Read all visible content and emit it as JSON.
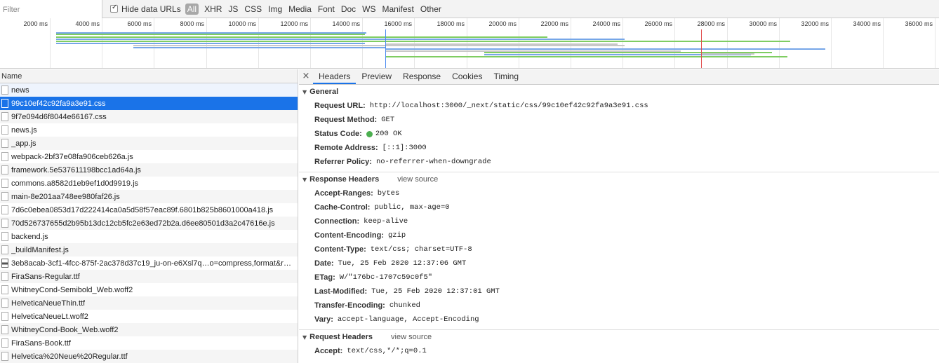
{
  "toolbar": {
    "filter_placeholder": "Filter",
    "hide_data_urls_label": "Hide data URLs",
    "hide_data_urls_checked": true,
    "types": [
      "All",
      "XHR",
      "JS",
      "CSS",
      "Img",
      "Media",
      "Font",
      "Doc",
      "WS",
      "Manifest",
      "Other"
    ],
    "active_type": "All"
  },
  "overview": {
    "tick_labels": [
      "2000 ms",
      "4000 ms",
      "6000 ms",
      "8000 ms",
      "10000 ms",
      "12000 ms",
      "14000 ms",
      "16000 ms",
      "18000 ms",
      "20000 ms",
      "22000 ms",
      "24000 ms",
      "26000 ms",
      "28000 ms",
      "30000 ms",
      "32000 ms",
      "34000 ms",
      "36000 ms"
    ]
  },
  "list": {
    "column_header": "Name",
    "selected_index": 1,
    "rows": [
      {
        "name": "news",
        "icon": "document-icon"
      },
      {
        "name": "99c10ef42c92fa9a3e91.css",
        "icon": "document-icon"
      },
      {
        "name": "9f7e094d6f8044e66167.css",
        "icon": "document-icon"
      },
      {
        "name": "news.js",
        "icon": "document-icon"
      },
      {
        "name": "_app.js",
        "icon": "document-icon"
      },
      {
        "name": "webpack-2bf37e08fa906ceb626a.js",
        "icon": "document-icon"
      },
      {
        "name": "framework.5e537611198bcc1ad64a.js",
        "icon": "document-icon"
      },
      {
        "name": "commons.a8582d1eb9ef1d0d9919.js",
        "icon": "document-icon"
      },
      {
        "name": "main-8e201aa748ee980faf26.js",
        "icon": "document-icon"
      },
      {
        "name": "7d6c0ebea0853d17d222414ca0a5d58f57eac89f.6801b825b8601000a418.js",
        "icon": "document-icon"
      },
      {
        "name": "70d526737655d2b95b13dc12cb5fc2e63ed72b2a.d6ee80501d3a2c47616e.js",
        "icon": "document-icon"
      },
      {
        "name": "backend.js",
        "icon": "document-icon"
      },
      {
        "name": "_buildManifest.js",
        "icon": "document-icon"
      },
      {
        "name": "3eb8acab-3cf1-4fcc-875f-2ac378d37c19_ju-on-e6Xsl7q…o=compress,format&r…",
        "icon": "image-icon"
      },
      {
        "name": "FiraSans-Regular.ttf",
        "icon": "document-icon"
      },
      {
        "name": "WhitneyCond-Semibold_Web.woff2",
        "icon": "document-icon"
      },
      {
        "name": "HelveticaNeueThin.ttf",
        "icon": "document-icon"
      },
      {
        "name": "HelveticaNeueLt.woff2",
        "icon": "document-icon"
      },
      {
        "name": "WhitneyCond-Book_Web.woff2",
        "icon": "document-icon"
      },
      {
        "name": "FiraSans-Book.ttf",
        "icon": "document-icon"
      },
      {
        "name": "Helvetica%20Neue%20Regular.ttf",
        "icon": "document-icon"
      }
    ]
  },
  "details": {
    "close_glyph": "×",
    "tabs": [
      "Headers",
      "Preview",
      "Response",
      "Cookies",
      "Timing"
    ],
    "active_tab": "Headers",
    "general": {
      "title": "General",
      "items": [
        {
          "key": "Request URL:",
          "value": "http://localhost:3000/_next/static/css/99c10ef42c92fa9a3e91.css"
        },
        {
          "key": "Request Method:",
          "value": "GET"
        },
        {
          "key": "Status Code:",
          "value": "200 OK",
          "status_color": "#4caf50"
        },
        {
          "key": "Remote Address:",
          "value": "[::1]:3000"
        },
        {
          "key": "Referrer Policy:",
          "value": "no-referrer-when-downgrade"
        }
      ]
    },
    "response_headers": {
      "title": "Response Headers",
      "view_source": "view source",
      "items": [
        {
          "key": "Accept-Ranges:",
          "value": "bytes"
        },
        {
          "key": "Cache-Control:",
          "value": "public, max-age=0"
        },
        {
          "key": "Connection:",
          "value": "keep-alive"
        },
        {
          "key": "Content-Encoding:",
          "value": "gzip"
        },
        {
          "key": "Content-Type:",
          "value": "text/css; charset=UTF-8"
        },
        {
          "key": "Date:",
          "value": "Tue, 25 Feb 2020 12:37:06 GMT"
        },
        {
          "key": "ETag:",
          "value": "W/\"176bc-1707c59c0f5\""
        },
        {
          "key": "Last-Modified:",
          "value": "Tue, 25 Feb 2020 12:37:01 GMT"
        },
        {
          "key": "Transfer-Encoding:",
          "value": "chunked"
        },
        {
          "key": "Vary:",
          "value": "accept-language, Accept-Encoding"
        }
      ]
    },
    "request_headers": {
      "title": "Request Headers",
      "view_source": "view source",
      "items": [
        {
          "key": "Accept:",
          "value": "text/css,*/*;q=0.1"
        }
      ]
    }
  },
  "colors": {
    "selection": "#1a73e8",
    "waterfall_blue": "#76a6e8",
    "waterfall_green": "#7fcd62",
    "dom_content_loaded_marker": "#4b8af0",
    "load_marker": "#e04a4a"
  }
}
